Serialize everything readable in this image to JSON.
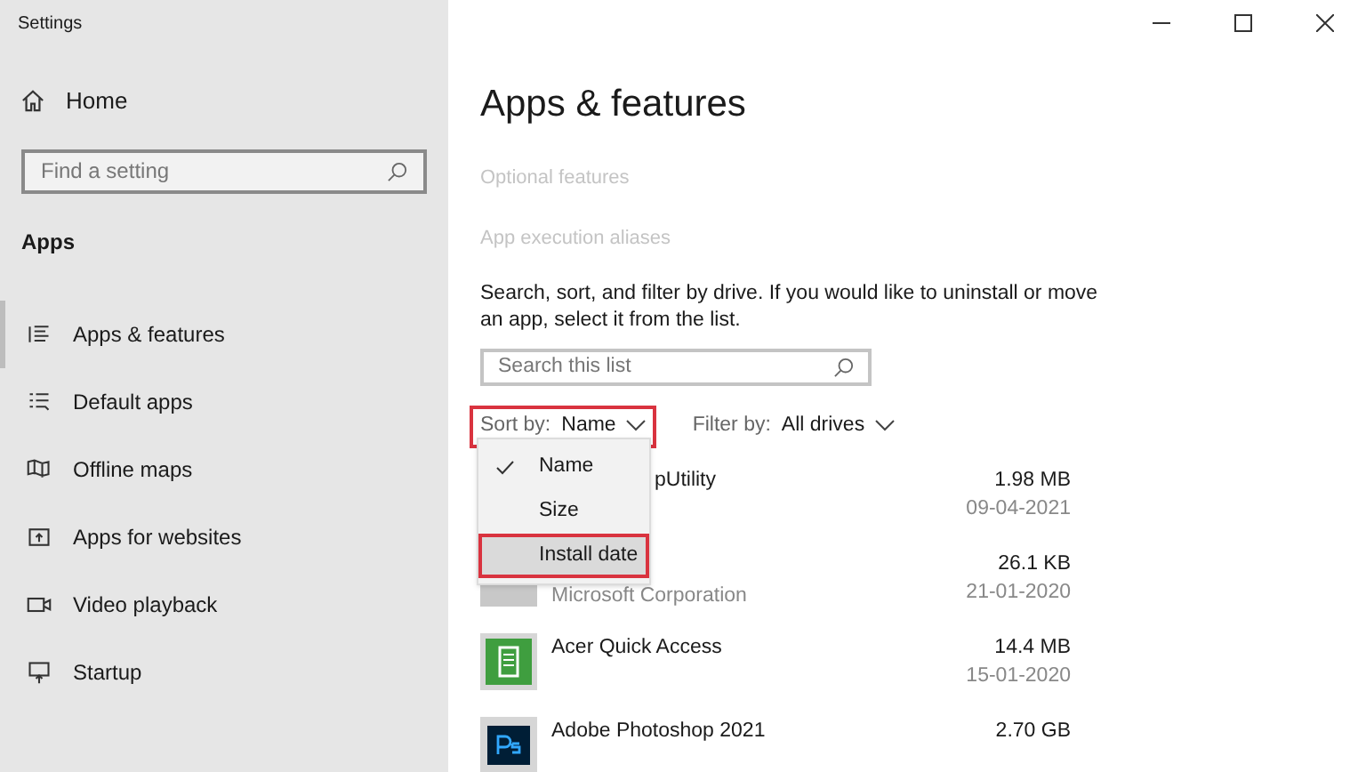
{
  "window": {
    "title": "Settings"
  },
  "sidebar": {
    "home": "Home",
    "search": {
      "placeholder": "Find a setting"
    },
    "section": "Apps",
    "items": [
      {
        "label": "Apps & features",
        "kind": "list",
        "selected": true
      },
      {
        "label": "Default apps",
        "kind": "defaults",
        "selected": false
      },
      {
        "label": "Offline maps",
        "kind": "map",
        "selected": false
      },
      {
        "label": "Apps for websites",
        "kind": "web",
        "selected": false
      },
      {
        "label": "Video playback",
        "kind": "video",
        "selected": false
      },
      {
        "label": "Startup",
        "kind": "startup",
        "selected": false
      }
    ]
  },
  "main": {
    "title": "Apps & features",
    "links": [
      "Optional features",
      "App execution aliases"
    ],
    "description": "Search, sort, and filter by drive. If you would like to uninstall or move an app, select it from the list.",
    "search": {
      "placeholder": "Search this list"
    },
    "sort": {
      "label": "Sort by:",
      "value": "Name",
      "highlighted": true
    },
    "filter": {
      "label": "Filter by:",
      "value": "All drives"
    },
    "sort_menu": [
      {
        "label": "Name",
        "checked": true,
        "highlighted": false
      },
      {
        "label": "Size",
        "checked": false,
        "highlighted": false
      },
      {
        "label": "Install date",
        "checked": false,
        "highlighted": true
      }
    ],
    "apps": [
      {
        "name": "pUtility",
        "kind": "none",
        "size": "1.98 MB",
        "date": "09-04-2021"
      },
      {
        "publisher": "Microsoft Corporation",
        "kind": "grey",
        "size": "26.1 KB",
        "date": "21-01-2020"
      },
      {
        "name": "Acer Quick Access",
        "kind": "acer",
        "size": "14.4 MB",
        "date": "15-01-2020"
      },
      {
        "name": "Adobe Photoshop 2021",
        "kind": "ps",
        "size": "2.70 GB"
      }
    ]
  }
}
